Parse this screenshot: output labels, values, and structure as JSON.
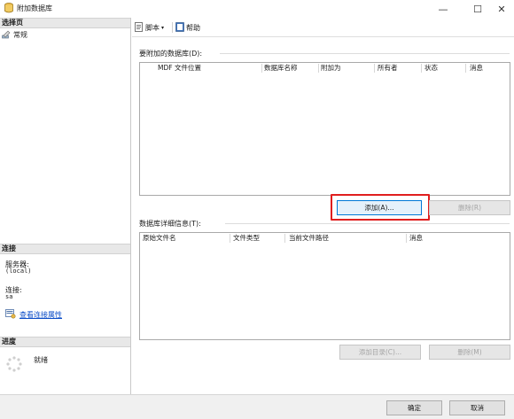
{
  "window": {
    "title": "附加数据库",
    "controls": {
      "minimize": "—",
      "maximize": "☐",
      "close": "✕"
    }
  },
  "left": {
    "select_page_header": "选择页",
    "pages": [
      {
        "label": "常规",
        "icon": "wrench-icon"
      }
    ],
    "connection_header": "连接",
    "server_label": "服务器:",
    "server_value": "(local)",
    "connect_label": "连接:",
    "connect_value": "sa",
    "view_props_link": "查看连接属性",
    "progress_header": "进度",
    "progress_status": "就绪"
  },
  "toolbar": {
    "script_label": "脚本",
    "help_label": "帮助"
  },
  "attach": {
    "group_label": "要附加的数据库(D):",
    "columns": [
      "MDF 文件位置",
      "数据库名称",
      "附加为",
      "所有者",
      "状态",
      "消息"
    ],
    "add_button": "添加(A)...",
    "remove_button": "删除(R)"
  },
  "details": {
    "group_label": "数据库详细信息(T):",
    "columns": [
      "原始文件名",
      "文件类型",
      "当前文件路径",
      "消息"
    ],
    "add_catalog_button": "添加目录(C)...",
    "remove_button": "删除(M)"
  },
  "footer": {
    "ok_button": "确定",
    "cancel_button": "取消"
  },
  "colors": {
    "highlight": "#e01e1e",
    "link": "#0b4cc7",
    "focus_border": "#0078d7"
  }
}
